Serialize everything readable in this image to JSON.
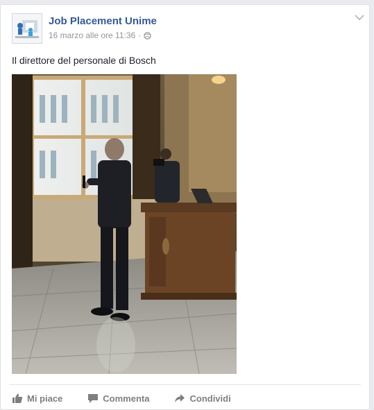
{
  "post": {
    "page_name": "Job Placement Unime",
    "timestamp": "16 marzo alle ore 11:36",
    "separator": "·",
    "audience_icon": "globe-icon",
    "text": "Il direttore del personale di Bosch",
    "photo_icon": "photo"
  },
  "actions": {
    "like_label": "Mi piace",
    "comment_label": "Commenta",
    "share_label": "Condividi"
  },
  "colors": {
    "link": "#365899",
    "meta": "#90949c",
    "action": "#7f7f7f"
  }
}
